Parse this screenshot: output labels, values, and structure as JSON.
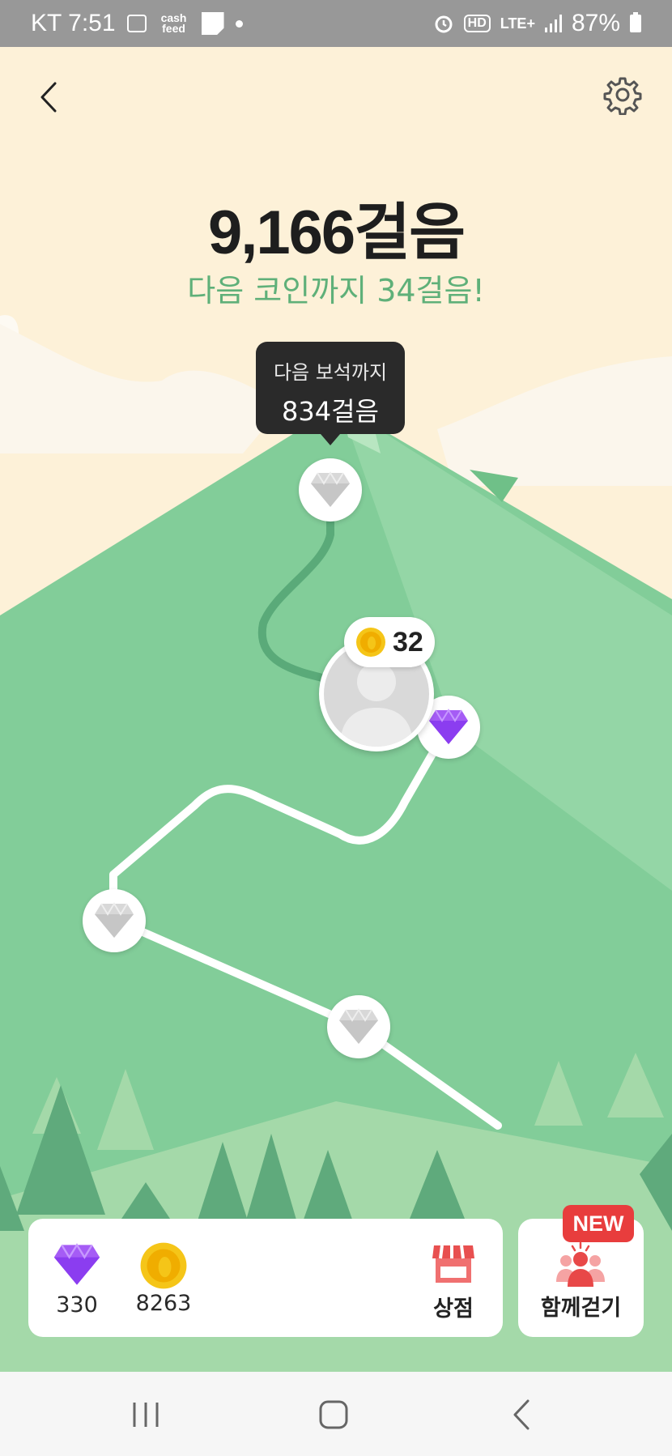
{
  "status_bar": {
    "carrier_time": "KT 7:51",
    "cashfeed_label": "cash feed",
    "hd_label": "HD",
    "network": "LTE+",
    "battery": "87%"
  },
  "header": {
    "back_icon": "chevron-left-icon",
    "settings_icon": "gear-icon"
  },
  "main": {
    "steps_title": "9,166걸음",
    "next_coin_text": "다음 코인까지 34걸음!"
  },
  "tooltip": {
    "line1": "다음 보석까지",
    "line2": "834걸음"
  },
  "coin_bubble": {
    "value": "32"
  },
  "bottom": {
    "gems_count": "330",
    "coins_count": "8263",
    "shop_label": "상점",
    "walk_together_label": "함께걷기",
    "new_badge": "NEW"
  },
  "colors": {
    "background": "#fdf1d8",
    "mountain": "#82cd99",
    "accent_green": "#5fb079",
    "new_badge": "#e83d3d",
    "gem_purple": "#8b3df0",
    "coin_gold": "#f5c518"
  }
}
